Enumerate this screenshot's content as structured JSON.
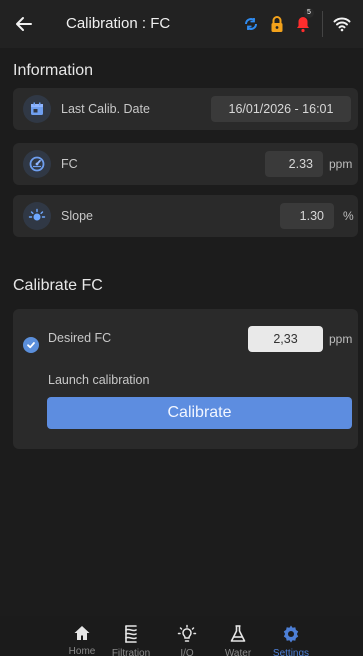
{
  "header": {
    "title": "Calibration : FC",
    "notification_count": "5",
    "icons": [
      "back-arrow-icon",
      "sync-icon",
      "lock-icon",
      "bell-icon",
      "wifi-icon"
    ]
  },
  "information": {
    "section_title": "Information",
    "rows": [
      {
        "label": "Last Calib. Date",
        "value": "16/01/2026 - 16:01",
        "unit": "",
        "icon": "calendar-icon"
      },
      {
        "label": "FC",
        "value": "2.33",
        "unit": "ppm",
        "icon": "gauge-icon"
      },
      {
        "label": "Slope",
        "value": "1.30",
        "unit": "%",
        "icon": "slope-sun-icon"
      }
    ]
  },
  "calibrate": {
    "section_title": "Calibrate FC",
    "desired_label": "Desired FC",
    "desired_value": "2,33",
    "desired_unit": "ppm",
    "launch_label": "Launch calibration",
    "button_label": "Calibrate"
  },
  "nav": {
    "items": [
      {
        "label": "Home",
        "icon": "home-icon"
      },
      {
        "label": "Filtration",
        "icon": "filtration-icon"
      },
      {
        "label": "I/O",
        "icon": "lightbulb-icon"
      },
      {
        "label": "Water",
        "icon": "flask-icon"
      },
      {
        "label": "Settings",
        "icon": "gear-icon"
      }
    ],
    "active_index": 4
  },
  "colors": {
    "background": "#1c1c1c",
    "card": "#2a2a2a",
    "accent_blue": "#5d8de0",
    "alert_red": "#ff2d2d",
    "lock_orange": "#f3a21b",
    "sync_blue": "#2f8bf0"
  }
}
